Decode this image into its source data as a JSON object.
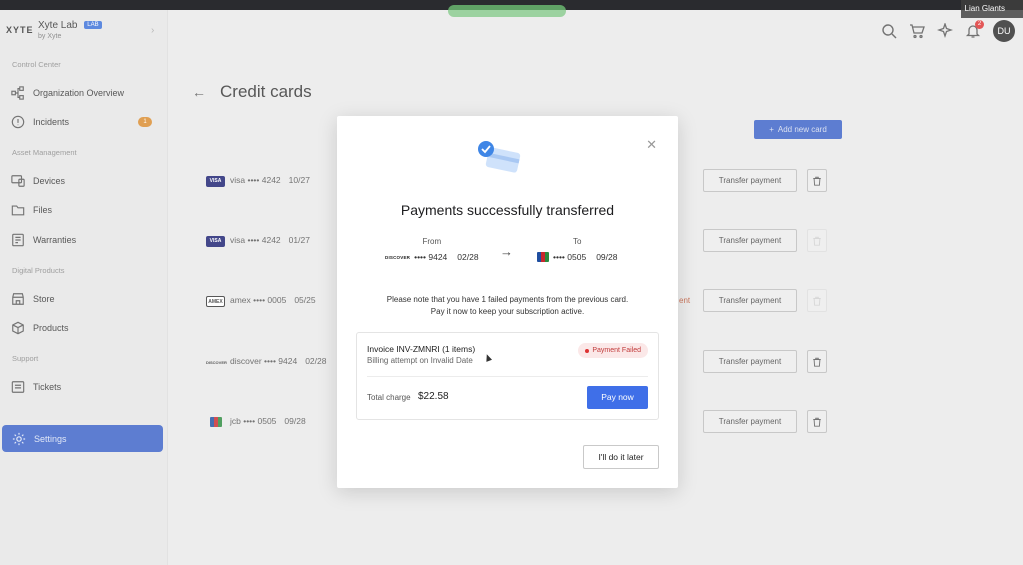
{
  "browser": {
    "participant_name": "Lian Glants"
  },
  "sidebar": {
    "brand": "XYTE",
    "org_name": "Xyte Lab",
    "org_badge": "LAB",
    "org_sub": "by Xyte",
    "sections": {
      "control_center": "Control Center",
      "asset_management": "Asset Management",
      "digital_products": "Digital Products",
      "support": "Support"
    },
    "items": {
      "organization_overview": "Organization Overview",
      "incidents": "Incidents",
      "incidents_count": "1",
      "devices": "Devices",
      "files": "Files",
      "warranties": "Warranties",
      "store": "Store",
      "products": "Products",
      "tickets": "Tickets",
      "settings": "Settings"
    }
  },
  "header": {
    "notifications_count": "2",
    "avatar_initials": "DU"
  },
  "main": {
    "title": "Credit cards",
    "add_button": "Add new card",
    "cards": [
      {
        "brand": "visa",
        "brand_logo": "VISA",
        "masked": "visa •••• 4242",
        "exp": "10/27",
        "action": "Transfer payment",
        "logo_color": "#1a1f71"
      },
      {
        "brand": "visa",
        "brand_logo": "VISA",
        "masked": "visa •••• 4242",
        "exp": "01/27",
        "action": "Transfer payment",
        "logo_color": "#1a1f71"
      },
      {
        "brand": "amex",
        "brand_logo": "AMEX",
        "masked": "amex •••• 0005",
        "exp": "05/25",
        "action": "Transfer payment",
        "extra": "ent",
        "logo_color": "#ffffff"
      },
      {
        "brand": "discover",
        "brand_logo": "DISCOVER",
        "masked": "discover •••• 9424",
        "exp": "02/28",
        "action": "Transfer payment",
        "logo_color": "#ffffff"
      },
      {
        "brand": "jcb",
        "brand_logo": "JCB",
        "masked": "jcb •••• 0505",
        "exp": "09/28",
        "action": "Transfer payment",
        "logo_color": "#ffffff"
      }
    ]
  },
  "modal": {
    "title": "Payments successfully transferred",
    "from_label": "From",
    "to_label": "To",
    "from_logo": "DISCOVER",
    "from_masked": "•••• 9424",
    "from_exp": "02/28",
    "to_masked": "•••• 0505",
    "to_exp": "09/28",
    "notice_line1": "Please note that you have 1 failed payments from the previous card.",
    "notice_line2": "Pay it now to keep your subscription active.",
    "invoice": {
      "title": "Invoice INV-ZMNRI (1 items)",
      "subtitle": "Billing attempt on Invalid Date",
      "status": "Payment Failed",
      "total_label": "Total charge",
      "total_value": "$22.58",
      "pay_button": "Pay now"
    },
    "later_button": "I'll do it later"
  },
  "colors": {
    "accent": "#3f6fe8",
    "sidebar_active": "#3a61c7",
    "failed_text": "#c13a3a",
    "failed_bg": "#fbe8e8"
  }
}
